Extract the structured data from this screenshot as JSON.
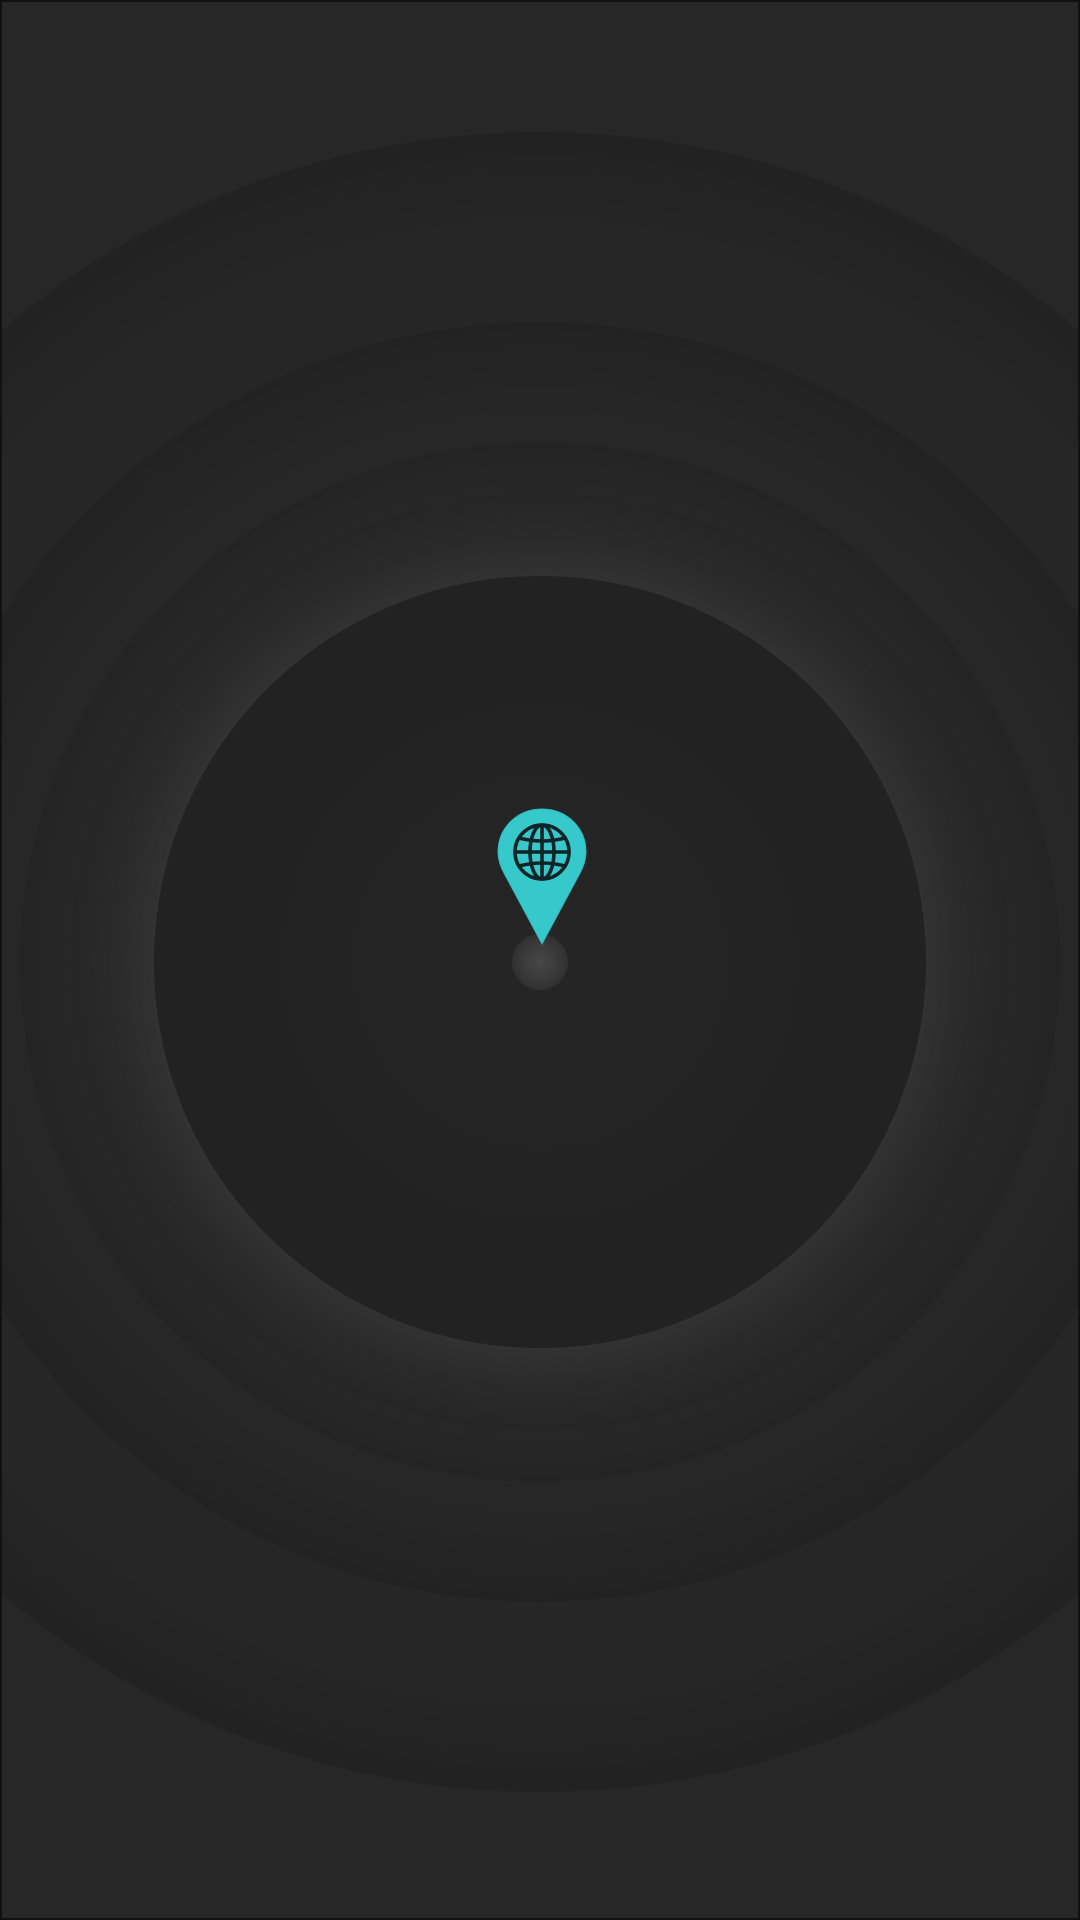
{
  "screen": {
    "background_color": "#262626",
    "core_color": "#222222"
  },
  "marker": {
    "icon": "location-pin-icon",
    "inner_icon": "globe-icon",
    "accent_color": "#37c8cc",
    "icon_line_color": "#0f2426"
  }
}
